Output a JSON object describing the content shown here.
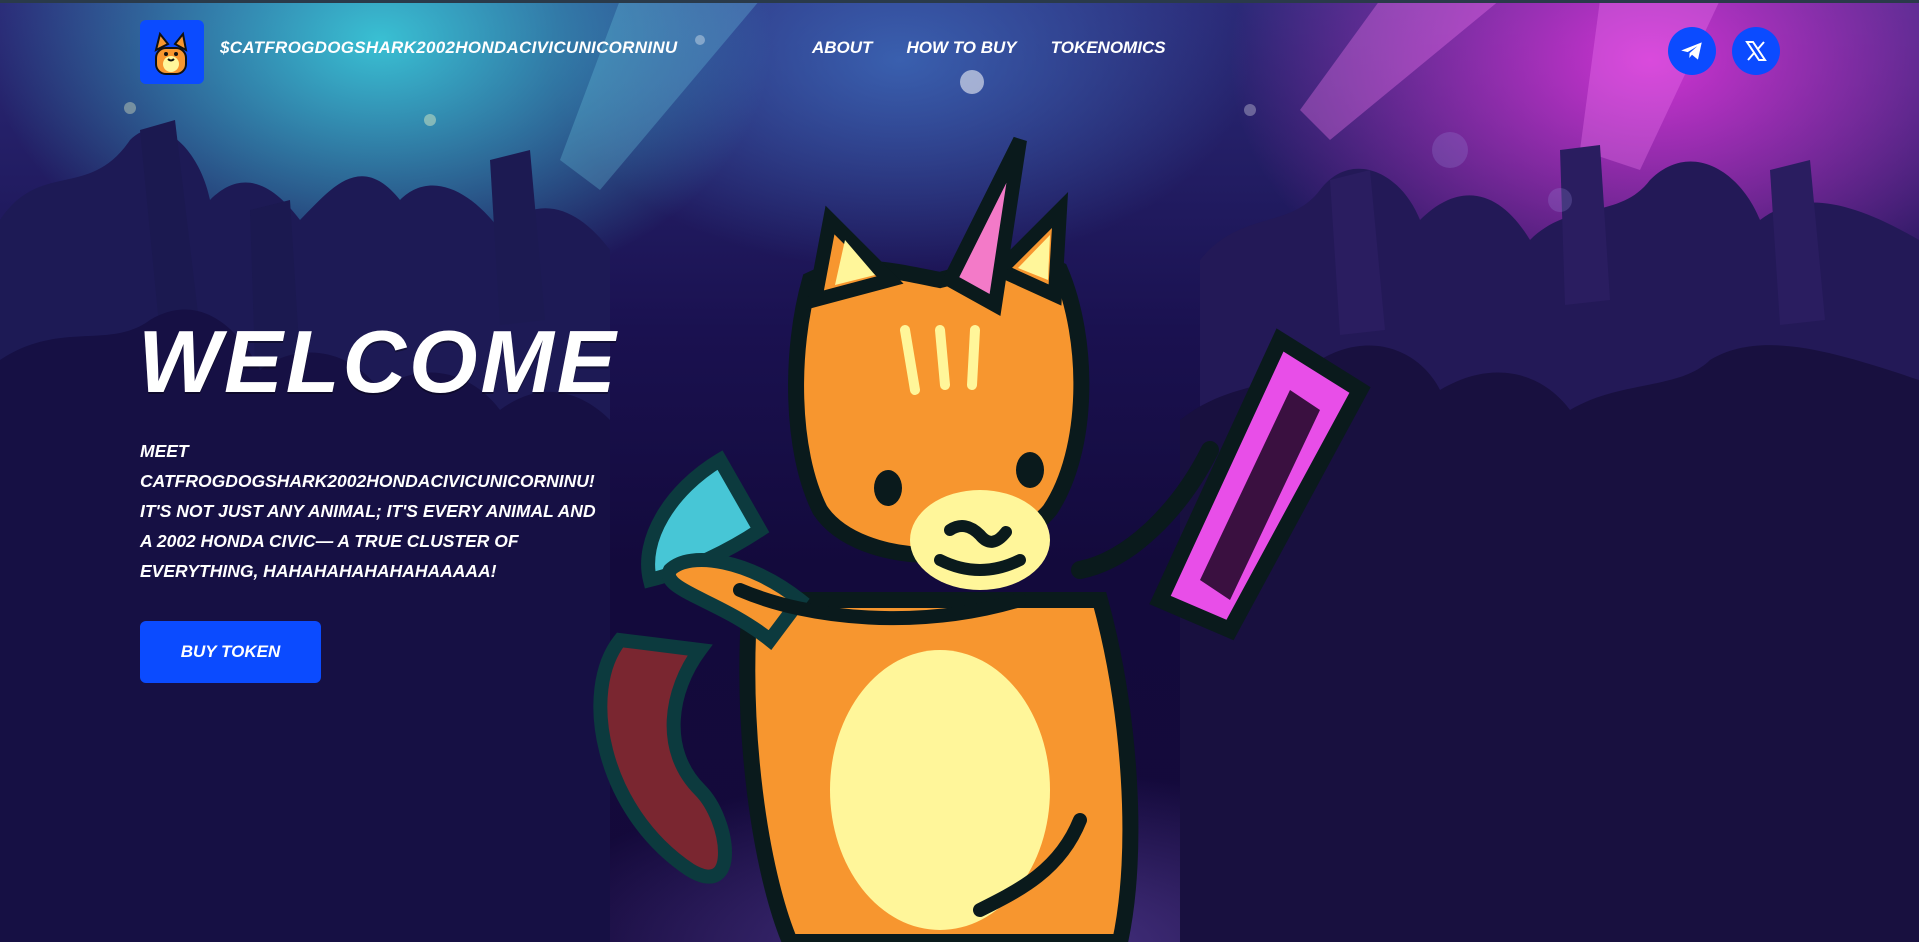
{
  "header": {
    "brand_name": "$CATFROGDOGSHARK2002HONDACIVICUNICORNINU",
    "logo_icon": "cat-mascot-icon",
    "nav": [
      {
        "label": "ABOUT"
      },
      {
        "label": "HOW TO BUY"
      },
      {
        "label": "TOKENOMICS"
      }
    ],
    "social": [
      {
        "icon": "telegram-icon"
      },
      {
        "icon": "x-twitter-icon"
      }
    ]
  },
  "hero": {
    "title": "WELCOME",
    "body": "MEET CATFROGDOGSHARK2002HONDACIVICUNICORNINU! IT'S NOT JUST ANY ANIMAL; IT'S EVERY ANIMAL AND A 2002 HONDA CIVIC— A TRUE CLUSTER OF EVERYTHING, HAHAHAHAHAHAHAAAAA!",
    "cta_label": "BUY TOKEN",
    "illustration": "dj-cat-unicorn-mascot"
  },
  "colors": {
    "accent": "#0b4bff",
    "background": "#130a3c",
    "cyan_light": "#3ac8d8",
    "magenta_light": "#d634d6",
    "mascot_orange": "#f7962f",
    "mascot_cream": "#fff69a",
    "horn_pink": "#f37ac8",
    "record_magenta": "#e84ee8"
  }
}
